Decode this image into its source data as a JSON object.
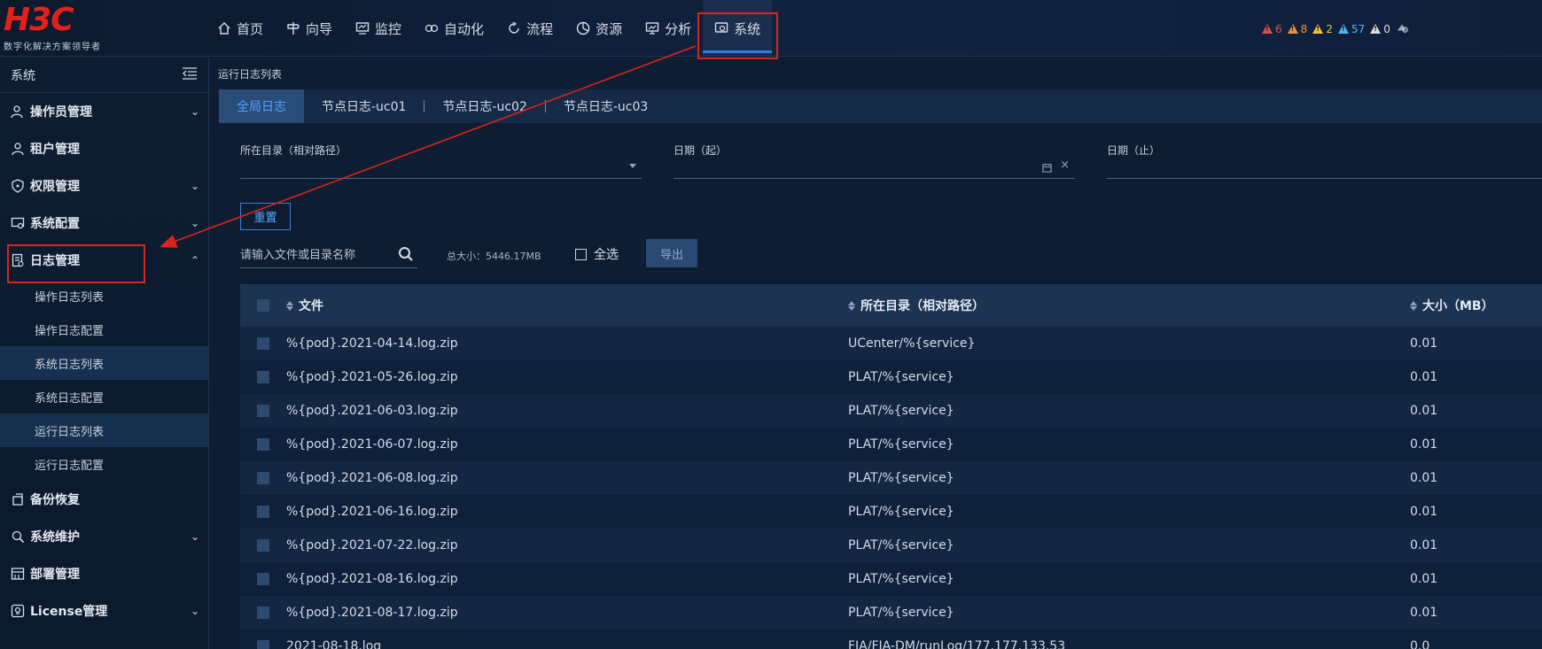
{
  "logo": {
    "mark": "H3C",
    "tagline": "数字化解决方案领导者"
  },
  "nav": {
    "items": [
      {
        "label": "首页",
        "icon": "home-icon"
      },
      {
        "label": "向导",
        "icon": "guide-icon"
      },
      {
        "label": "监控",
        "icon": "monitor-icon"
      },
      {
        "label": "自动化",
        "icon": "automation-icon"
      },
      {
        "label": "流程",
        "icon": "process-icon"
      },
      {
        "label": "资源",
        "icon": "resource-icon"
      },
      {
        "label": "分析",
        "icon": "analysis-icon"
      },
      {
        "label": "系统",
        "icon": "system-icon",
        "active": true
      }
    ]
  },
  "alarms": {
    "items": [
      {
        "count": "6",
        "color": "#e05050"
      },
      {
        "count": "8",
        "color": "#f0903a"
      },
      {
        "count": "2",
        "color": "#f0c33a"
      },
      {
        "count": "57",
        "color": "#4ab8e8"
      },
      {
        "count": "0",
        "color": "#dddddd"
      }
    ]
  },
  "sidebar": {
    "title": "系统",
    "groups": [
      {
        "label": "操作员管理",
        "icon": "operator-icon",
        "chevron": "down"
      },
      {
        "label": "租户管理",
        "icon": "tenant-icon",
        "chevron": ""
      },
      {
        "label": "权限管理",
        "icon": "permission-icon",
        "chevron": "down"
      },
      {
        "label": "系统配置",
        "icon": "config-icon",
        "chevron": "down"
      },
      {
        "label": "日志管理",
        "icon": "log-icon",
        "chevron": "up",
        "subs": [
          {
            "label": "操作日志列表",
            "active": false
          },
          {
            "label": "操作日志配置",
            "active": false
          },
          {
            "label": "系统日志列表",
            "active": true
          },
          {
            "label": "系统日志配置",
            "active": false
          },
          {
            "label": "运行日志列表",
            "active": true
          },
          {
            "label": "运行日志配置",
            "active": false
          }
        ]
      },
      {
        "label": "备份恢复",
        "icon": "backup-icon",
        "chevron": ""
      },
      {
        "label": "系统维护",
        "icon": "maintenance-icon",
        "chevron": "down"
      },
      {
        "label": "部署管理",
        "icon": "deploy-icon",
        "chevron": ""
      },
      {
        "label": "License管理",
        "icon": "license-icon",
        "chevron": "down"
      }
    ]
  },
  "breadcrumb": "运行日志列表",
  "tabs": [
    {
      "label": "全局日志",
      "active": true
    },
    {
      "label": "节点日志-uc01",
      "active": false
    },
    {
      "label": "节点日志-uc02",
      "active": false
    },
    {
      "label": "节点日志-uc03",
      "active": false
    }
  ],
  "filters": {
    "dir_label": "所在目录（相对路径）",
    "date_start_label": "日期（起）",
    "date_end_label": "日期（止）"
  },
  "reset_label": "重置",
  "search": {
    "placeholder": "请输入文件或目录名称"
  },
  "total_size": "总大小：5446.17MB",
  "select_all_label": "全选",
  "export_label": "导出",
  "table": {
    "headers": {
      "file": "文件",
      "dir": "所在目录（相对路径）",
      "size": "大小（MB）"
    },
    "rows": [
      {
        "file": "%{pod}.2021-04-14.log.zip",
        "dir": "UCenter/%{service}",
        "size": "0.01"
      },
      {
        "file": "%{pod}.2021-05-26.log.zip",
        "dir": "PLAT/%{service}",
        "size": "0.01"
      },
      {
        "file": "%{pod}.2021-06-03.log.zip",
        "dir": "PLAT/%{service}",
        "size": "0.01"
      },
      {
        "file": "%{pod}.2021-06-07.log.zip",
        "dir": "PLAT/%{service}",
        "size": "0.01"
      },
      {
        "file": "%{pod}.2021-06-08.log.zip",
        "dir": "PLAT/%{service}",
        "size": "0.01"
      },
      {
        "file": "%{pod}.2021-06-16.log.zip",
        "dir": "PLAT/%{service}",
        "size": "0.01"
      },
      {
        "file": "%{pod}.2021-07-22.log.zip",
        "dir": "PLAT/%{service}",
        "size": "0.01"
      },
      {
        "file": "%{pod}.2021-08-16.log.zip",
        "dir": "PLAT/%{service}",
        "size": "0.01"
      },
      {
        "file": "%{pod}.2021-08-17.log.zip",
        "dir": "PLAT/%{service}",
        "size": "0.01"
      },
      {
        "file": "2021-08-18.log",
        "dir": "FIA/FIA-DM/runLog/177.177.133.53",
        "size": "0.0"
      }
    ]
  }
}
